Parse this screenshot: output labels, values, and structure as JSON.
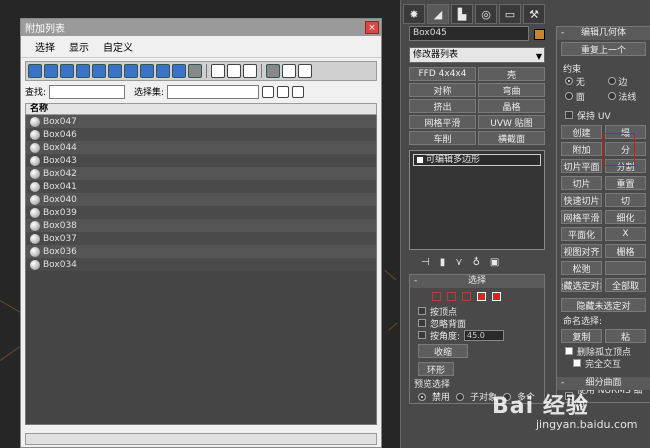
{
  "dialog": {
    "title": "附加列表",
    "close_glyph": "×",
    "menu": [
      "选择",
      "显示",
      "自定义"
    ],
    "find_label": "查找:",
    "selset_label": "选择集:",
    "list_header": "名称",
    "items": [
      "Box047",
      "Box046",
      "Box044",
      "Box043",
      "Box042",
      "Box041",
      "Box040",
      "Box039",
      "Box038",
      "Box037",
      "Box036",
      "Box034"
    ]
  },
  "command_panel": {
    "object_name": "Box045",
    "object_color": "#c8842e",
    "modifier_list": "修改器列表",
    "modifier_buttons": [
      "FFD 4x4x4",
      "壳",
      "对称",
      "弯曲",
      "挤出",
      "晶格",
      "网格平滑",
      "UVW 贴图",
      "车削",
      "横截面"
    ],
    "stack_item": "可编辑多边形",
    "selection": {
      "title": "选择",
      "by_vertex": "按顶点",
      "ignore_back": "忽略背面",
      "by_angle": "按角度:",
      "angle_value": "45.0",
      "shrink": "收缩",
      "ring": "环形",
      "preview": "预览选择",
      "disable": "禁用",
      "subobject": "子对象",
      "multi": "多个"
    },
    "edit_geometry": {
      "title": "编辑几何体",
      "repeat_last": "重复上一个",
      "constraint": "约束",
      "none": "无",
      "edge": "边",
      "face": "面",
      "normal": "法线",
      "preserve_uv": "保持 UV",
      "create": "创建",
      "collapse": "塌",
      "attach": "附加",
      "detach": "分",
      "slice_plane": "切片平面",
      "split": "分割",
      "slice": "切片",
      "reset": "重置",
      "quickslice": "快速切片",
      "cut": "切",
      "meshsmooth": "网格平滑",
      "tess": "细化",
      "planar": "平面化",
      "x": "X",
      "viewalign": "视图对齐",
      "gridalign": "栅格",
      "relax": "松弛",
      "hide_sel": "隐藏选定对象",
      "unhide_all": "全部取",
      "hide_unsel": "隐藏未选定对",
      "named_sel": "命名选择:",
      "copy": "复制",
      "paste": "粘",
      "del_iso": "删除孤立顶点",
      "full_int": "完全交互",
      "subdiv_surface": "细分曲面",
      "use_nurms": "使用 NURMS 细分"
    }
  },
  "watermark": {
    "main": "Bai 经验",
    "sub": "jingyan.baidu.com"
  }
}
